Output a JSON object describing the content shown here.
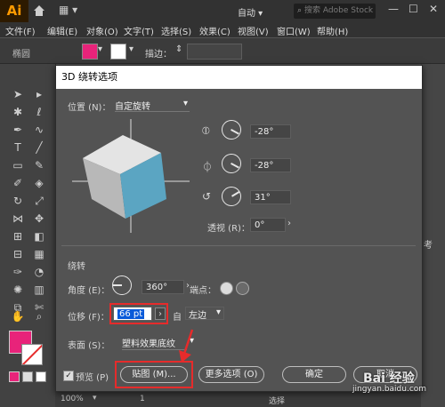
{
  "app": {
    "logo": "Ai",
    "workspace": "自动",
    "search_placeholder": "搜索 Adobe Stock"
  },
  "menu": [
    "文件(F)",
    "编辑(E)",
    "对象(O)",
    "文字(T)",
    "选择(S)",
    "效果(C)",
    "视图(V)",
    "窗口(W)",
    "帮助(H)"
  ],
  "controlbar": {
    "shape_label": "椭圆",
    "stroke_label": "描边："
  },
  "dialog": {
    "title": "3D 绕转选项",
    "position_label": "位置 (N)：",
    "position_value": "自定旋转",
    "rot_x": "-28°",
    "rot_y": "-28°",
    "rot_z": "31°",
    "perspective_label": "透视 (R)：",
    "perspective_value": "0°",
    "revolve_section": "绕转",
    "angle_label": "角度 (E)：",
    "angle_value": "360°",
    "endcap_label": "端点：",
    "offset_label": "位移 (F)：",
    "offset_value": "66 pt",
    "offset_from_label": "自",
    "offset_from_value": "左边",
    "surface_label": "表面 (S)：",
    "surface_value": "塑料效果底纹",
    "preview_label": "预览 (P)",
    "map_button": "贴图 (M)...",
    "more_button": "更多选项 (O)",
    "ok_button": "确定",
    "cancel_button": "取消"
  },
  "statusbar": {
    "zoom": "100%",
    "page": "1",
    "mode": "选择"
  },
  "right_panel_text": "考",
  "watermark": {
    "brand": "Bai 经验",
    "url": "jingyan.baidu.com"
  },
  "colors": {
    "fill": "#e8237a",
    "cube_top": "#e4e4e4",
    "cube_left": "#b8b8b8",
    "cube_right": "#5ba5c2",
    "highlight": "#e62b2b"
  }
}
